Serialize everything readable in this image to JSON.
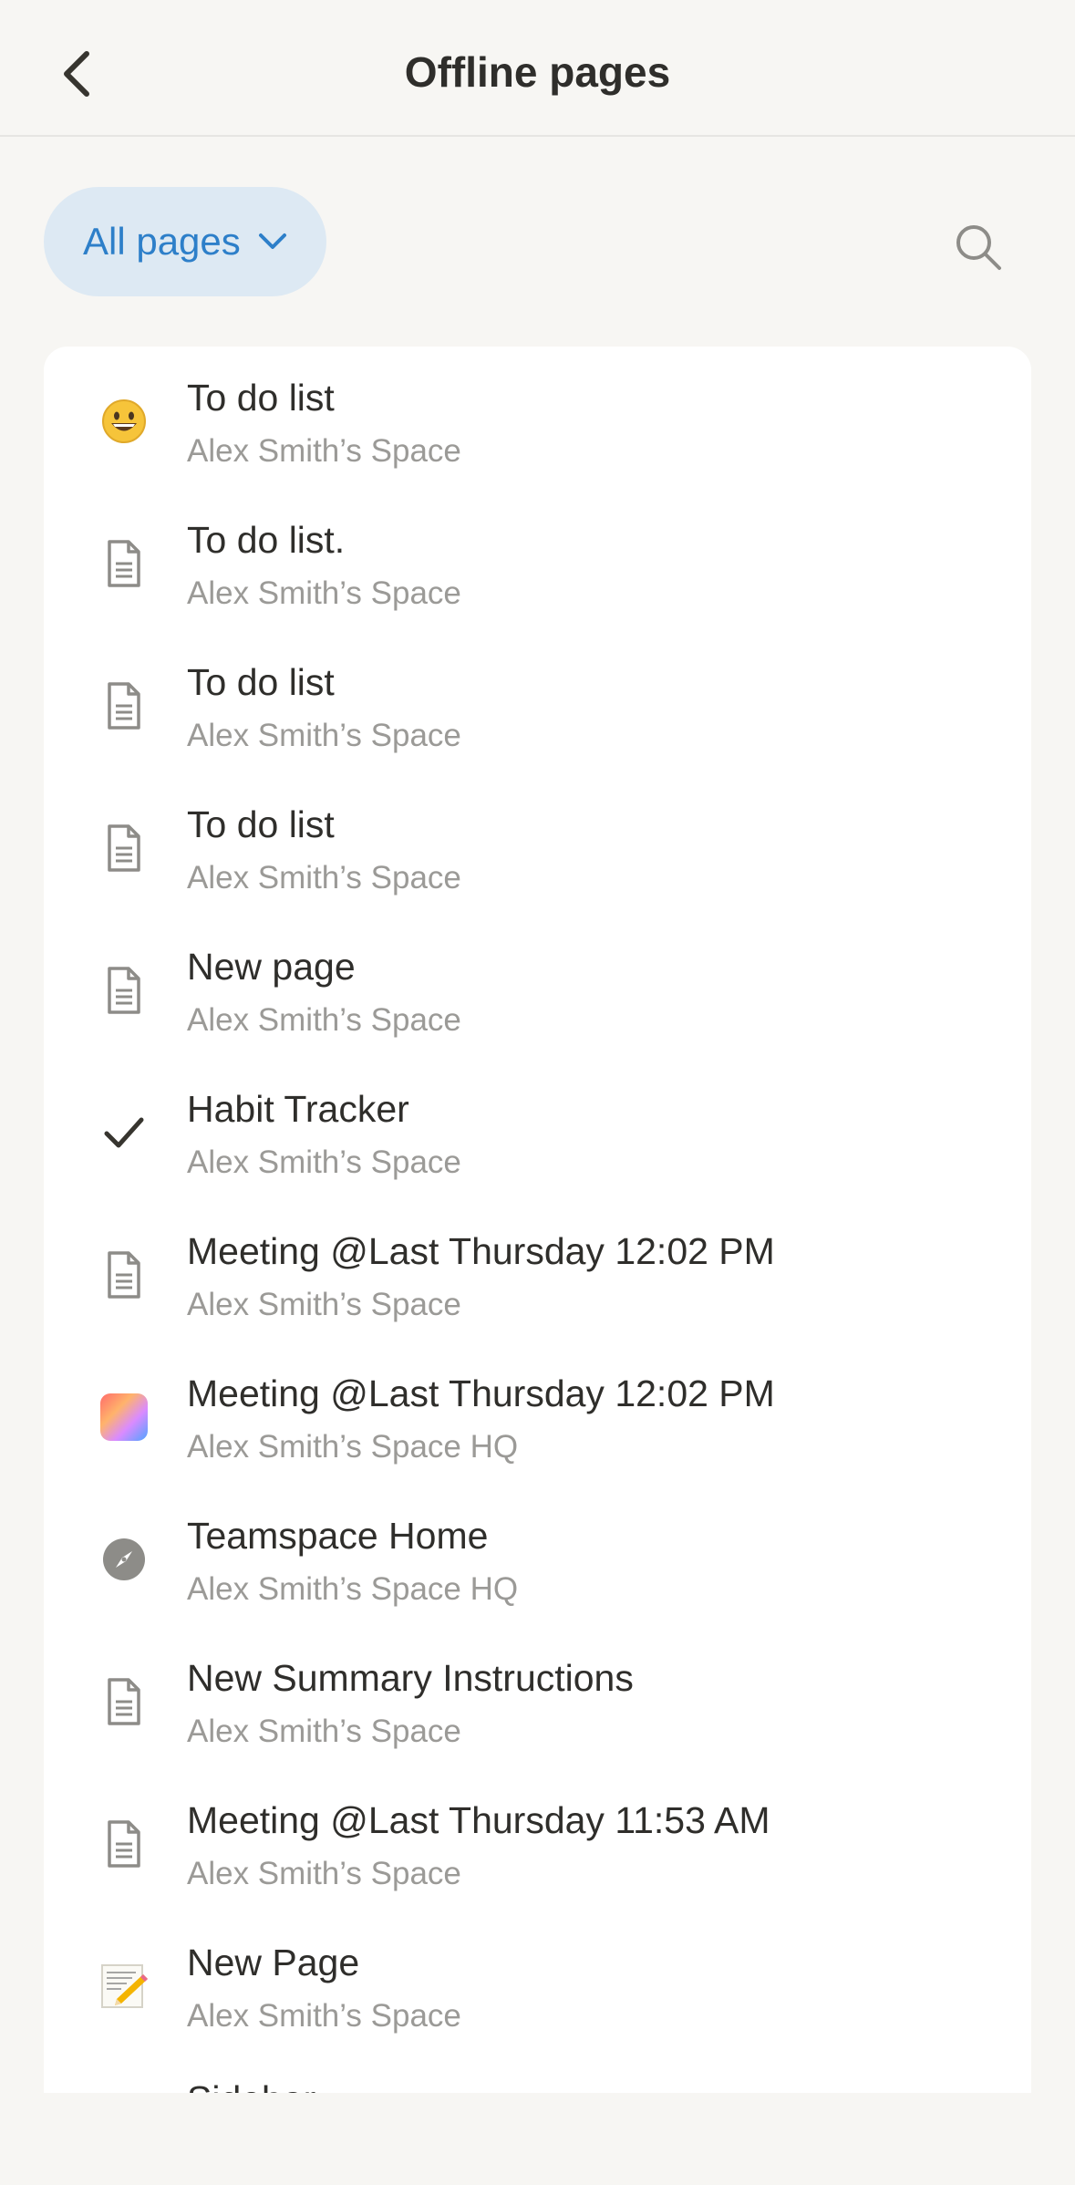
{
  "header": {
    "title": "Offline pages",
    "back_icon": "chevron-left-icon"
  },
  "filter": {
    "label": "All pages",
    "chevron_icon": "chevron-down-icon",
    "search_icon": "search-icon"
  },
  "colors": {
    "accent": "#2d7fc9",
    "pill_bg": "#dde9f3",
    "background": "#f7f6f3",
    "card": "#ffffff",
    "secondary_text": "#9b9a97"
  },
  "pages": [
    {
      "title": "To do list",
      "space": "Alex Smith’s Space",
      "icon": "grinning-face-emoji-icon"
    },
    {
      "title": "To do list.",
      "space": "Alex Smith’s Space",
      "icon": "page-icon"
    },
    {
      "title": "To do list",
      "space": "Alex Smith’s Space",
      "icon": "page-icon"
    },
    {
      "title": "To do list",
      "space": "Alex Smith’s Space",
      "icon": "page-icon"
    },
    {
      "title": "New page",
      "space": "Alex Smith’s Space",
      "icon": "page-icon"
    },
    {
      "title": "Habit Tracker",
      "space": "Alex Smith’s Space",
      "icon": "checkmark-icon"
    },
    {
      "title": "Meeting @Last Thursday 12:02 PM",
      "space": "Alex Smith’s Space",
      "icon": "page-icon"
    },
    {
      "title": "Meeting @Last Thursday 12:02 PM",
      "space": "Alex Smith’s Space HQ",
      "icon": "gradient-square-icon"
    },
    {
      "title": "Teamspace Home",
      "space": "Alex Smith’s Space HQ",
      "icon": "compass-icon"
    },
    {
      "title": "New Summary Instructions",
      "space": "Alex Smith’s Space",
      "icon": "page-icon"
    },
    {
      "title": "Meeting @Last Thursday 11:53 AM",
      "space": "Alex Smith’s Space",
      "icon": "page-icon"
    },
    {
      "title": "New Page",
      "space": "Alex Smith’s Space",
      "icon": "memo-emoji-icon"
    }
  ],
  "partial_item_title": "Sidebar"
}
